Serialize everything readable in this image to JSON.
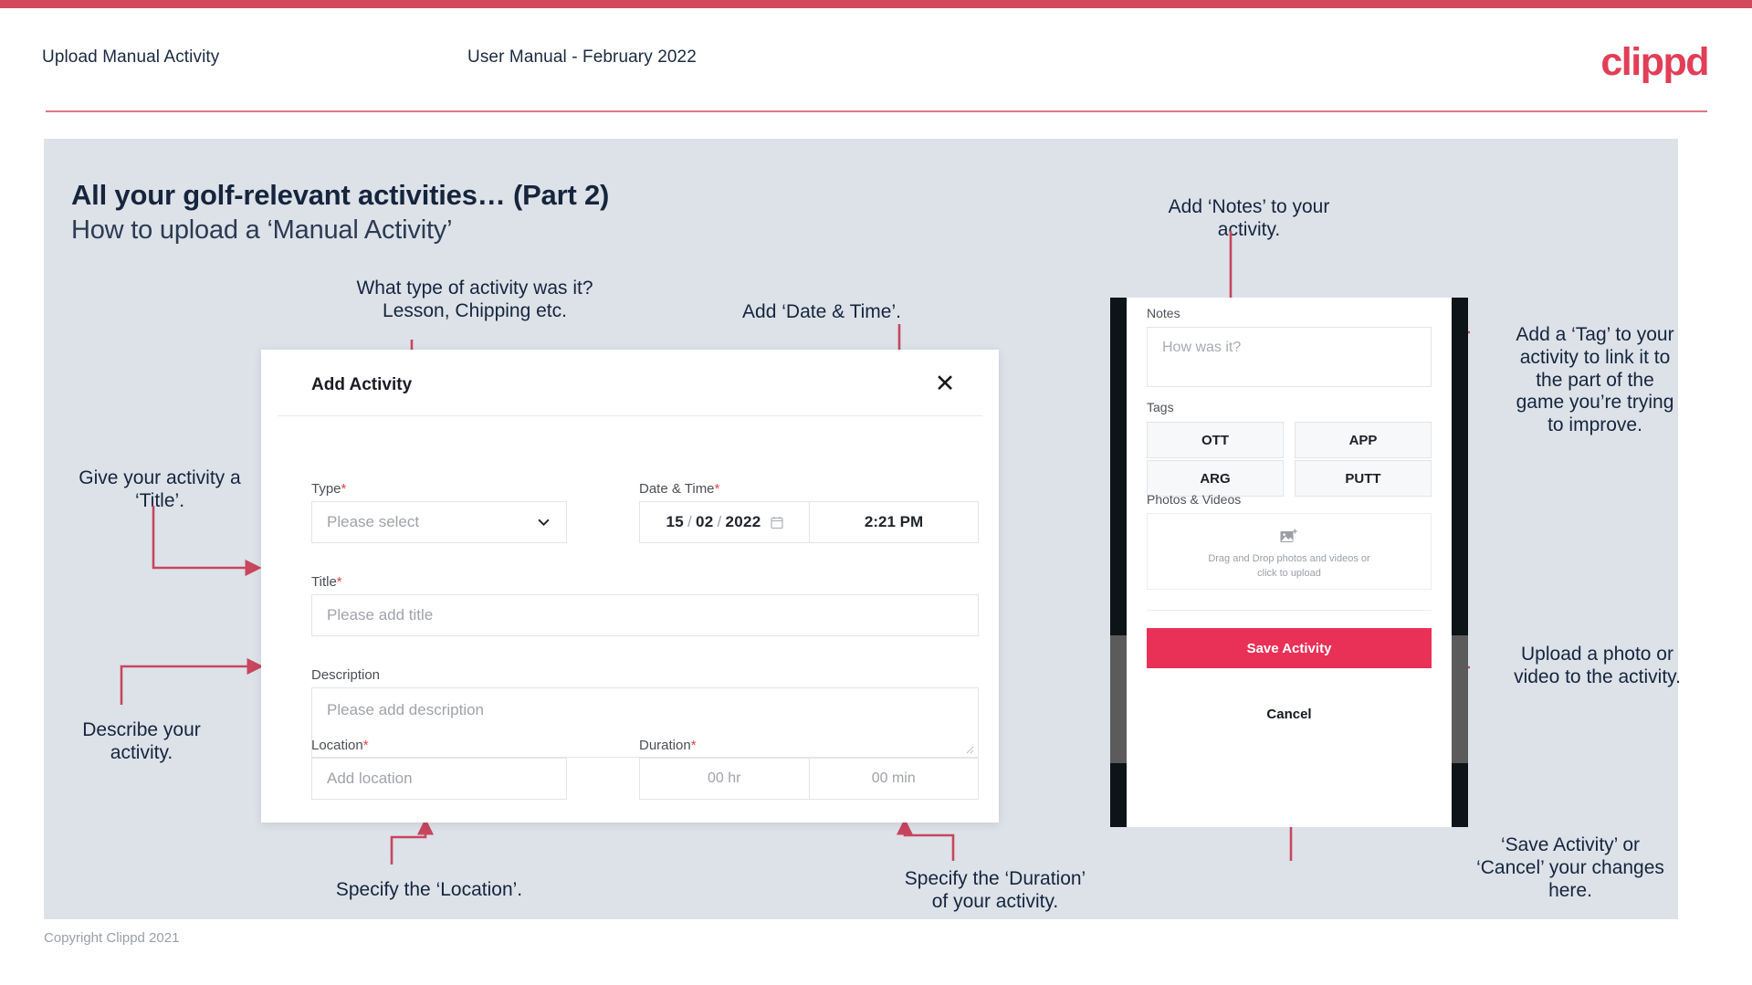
{
  "header": {
    "left_title": "Upload Manual Activity",
    "center_title": "User Manual - February 2022",
    "logo": "clippd"
  },
  "slide": {
    "title_line1": "All your golf-relevant activities… (Part 2)",
    "title_line2": "How to upload a ‘Manual Activity’"
  },
  "annotations": {
    "type": "What type of activity was it?\nLesson, Chipping etc.",
    "datetime": "Add ‘Date & Time’.",
    "title": "Give your activity a\n‘Title’.",
    "description": "Describe your\nactivity.",
    "location": "Specify the ‘Location’.",
    "duration": "Specify the ‘Duration’\nof your activity.",
    "notes": "Add ‘Notes’ to your\nactivity.",
    "tags": "Add a ‘Tag’ to your\nactivity to link it to\nthe part of the\ngame you’re trying\nto improve.",
    "upload": "Upload a photo or\nvideo to the activity.",
    "save": "‘Save Activity’ or\n‘Cancel’ your changes\nhere."
  },
  "dialog": {
    "title": "Add Activity",
    "close_icon": "close-icon",
    "fields": {
      "type": {
        "label": "Type",
        "required": "*",
        "placeholder": "Please select"
      },
      "datetime": {
        "label": "Date & Time",
        "required": "*",
        "day": "15",
        "month": "02",
        "year": "2022",
        "sep": "/",
        "time": "2:21 PM"
      },
      "title": {
        "label": "Title",
        "required": "*",
        "placeholder": "Please add title"
      },
      "description": {
        "label": "Description",
        "placeholder": "Please add description"
      },
      "location": {
        "label": "Location",
        "required": "*",
        "placeholder": "Add location"
      },
      "duration": {
        "label": "Duration",
        "required": "*",
        "hours": "00 hr",
        "minutes": "00 min"
      }
    }
  },
  "phone": {
    "notes_label": "Notes",
    "notes_placeholder": "How was it?",
    "tags_label": "Tags",
    "tags": [
      "OTT",
      "APP",
      "ARG",
      "PUTT"
    ],
    "photos_label": "Photos & Videos",
    "drop_text": "Drag and Drop photos and videos or\nclick to upload",
    "save_label": "Save Activity",
    "cancel_label": "Cancel"
  },
  "footer": {
    "copyright": "Copyright Clippd 2021"
  },
  "colors": {
    "accent": "#d1495b",
    "brand": "#e23e57",
    "save": "#e93057",
    "slide_bg": "#dde2e9",
    "arrow": "#c8465e"
  }
}
